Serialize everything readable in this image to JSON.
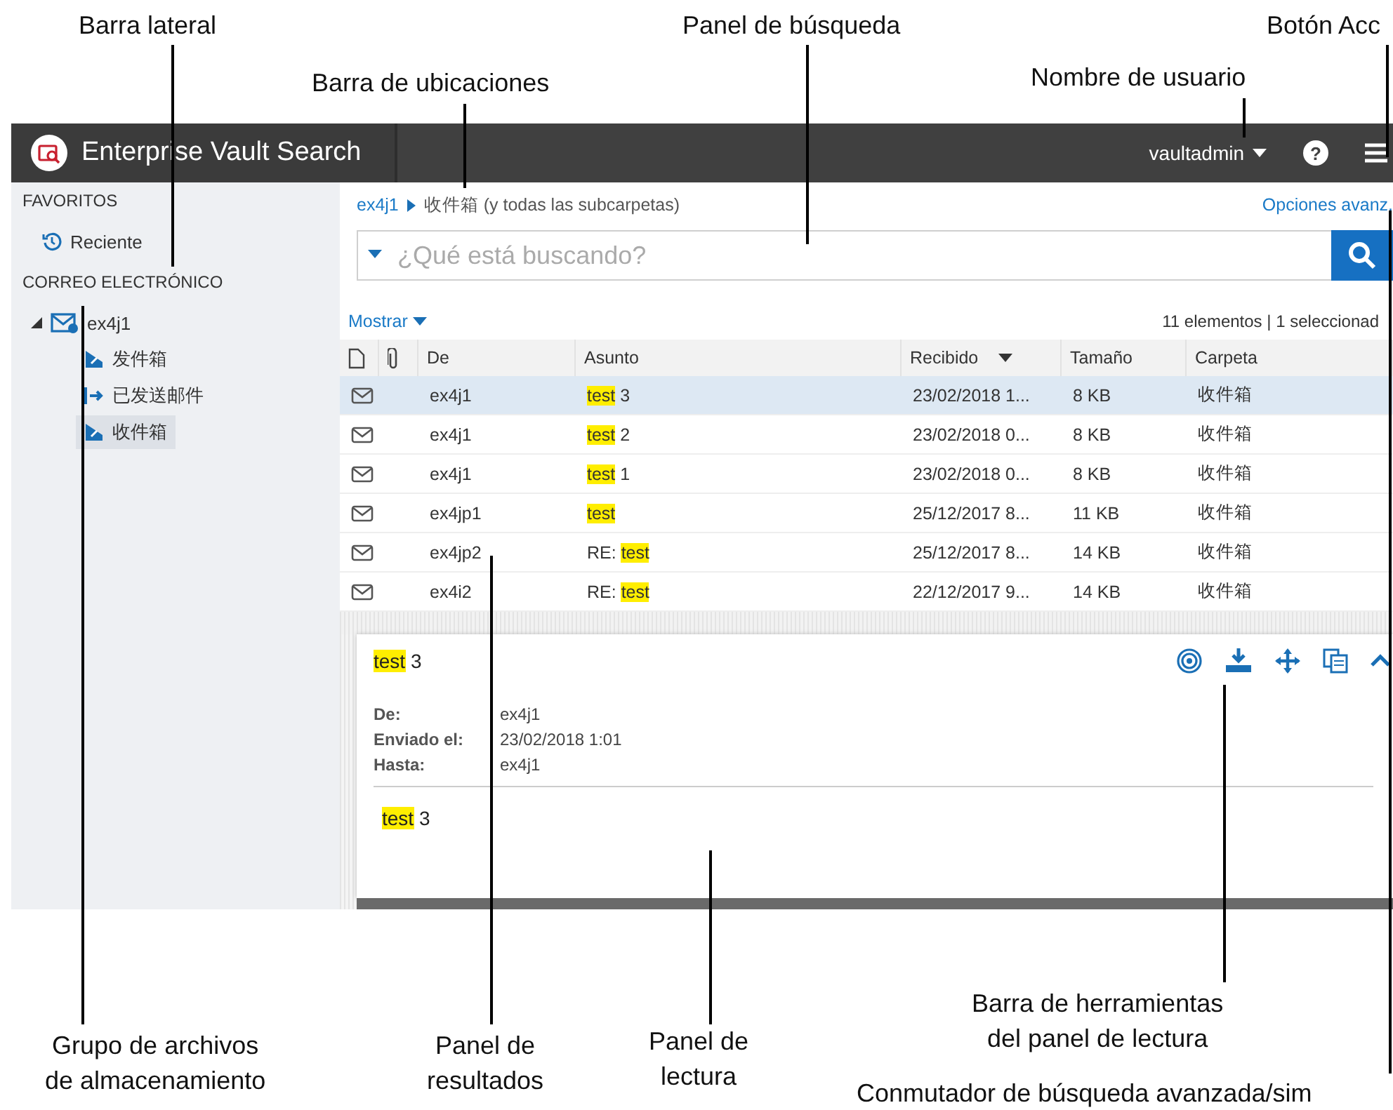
{
  "app": {
    "title": "Enterprise Vault Search",
    "user": "vaultadmin",
    "help_icon": "?"
  },
  "sidebar": {
    "favorites_heading": "FAVORITOS",
    "favorites": [
      {
        "label": "Reciente"
      }
    ],
    "email_heading": "CORREO ELECTRÓNICO",
    "tree": [
      {
        "label": "ex4j1",
        "expanded": true,
        "selected": false,
        "children": [
          {
            "label": "发件箱",
            "kind": "outbox",
            "selected": false
          },
          {
            "label": "已发送邮件",
            "kind": "sent",
            "selected": false
          },
          {
            "label": "收件箱",
            "kind": "inbox",
            "selected": true
          }
        ]
      }
    ]
  },
  "breadcrumb": {
    "root": "ex4j1",
    "path": "收件箱 (y todas las subcarpetas)"
  },
  "advanced_link": "Opciones avanz.",
  "search": {
    "placeholder": "¿Qué está buscando?"
  },
  "results": {
    "show_menu": "Mostrar",
    "count": "11 elementos",
    "count_separator": "|",
    "selected_count": "1 seleccionad",
    "columns": [
      "De",
      "Asunto",
      "Recibido",
      "Tamaño",
      "Carpeta"
    ],
    "rows": [
      {
        "from": "ex4j1",
        "subject": {
          "match": "test",
          "suffix": " 3"
        },
        "received": "23/02/2018 1...",
        "size": "8 KB",
        "folder": "收件箱",
        "selected": true
      },
      {
        "from": "ex4j1",
        "subject": {
          "match": "test",
          "suffix": " 2"
        },
        "received": "23/02/2018 0...",
        "size": "8 KB",
        "folder": "收件箱",
        "selected": false
      },
      {
        "from": "ex4j1",
        "subject": {
          "match": "test",
          "suffix": " 1"
        },
        "received": "23/02/2018 0...",
        "size": "8 KB",
        "folder": "收件箱",
        "selected": false
      },
      {
        "from": "ex4jp1",
        "subject": {
          "match": "test"
        },
        "received": "25/12/2017 8...",
        "size": "11 KB",
        "folder": "收件箱",
        "selected": false
      },
      {
        "from": "ex4jp2",
        "subject": {
          "prefix": "RE: ",
          "match": "test"
        },
        "received": "25/12/2017 8...",
        "size": "14 KB",
        "folder": "收件箱",
        "selected": false
      },
      {
        "from": "ex4i2",
        "subject": {
          "prefix": "RE: ",
          "match": "test"
        },
        "received": "22/12/2017 9...",
        "size": "14 KB",
        "folder": "收件箱",
        "selected": false
      }
    ]
  },
  "reading": {
    "title": {
      "match": "test",
      "suffix": " 3"
    },
    "fields": [
      {
        "label": "De:",
        "value": "ex4j1"
      },
      {
        "label": "Enviado el:",
        "value": "23/02/2018 1:01"
      },
      {
        "label": "Hasta:",
        "value": "ex4j1"
      }
    ],
    "body": {
      "match": "test",
      "suffix": " 3"
    }
  },
  "annotations": [
    {
      "lines": [
        "Barra lateral"
      ]
    },
    {
      "lines": [
        "Panel de búsqueda"
      ]
    },
    {
      "lines": [
        "Botón Acc"
      ]
    },
    {
      "lines": [
        "Barra de ubicaciones"
      ]
    },
    {
      "lines": [
        "Nombre de usuario"
      ]
    },
    {
      "lines": [
        "Barra de herramientas",
        "del panel de lectura"
      ]
    },
    {
      "lines": [
        "Grupo de archivos",
        "de almacenamiento"
      ]
    },
    {
      "lines": [
        "Panel de",
        "resultados"
      ]
    },
    {
      "lines": [
        "Panel de",
        "lectura"
      ]
    },
    {
      "lines": [
        "Conmutador de búsqueda avanzada/sim"
      ]
    }
  ]
}
